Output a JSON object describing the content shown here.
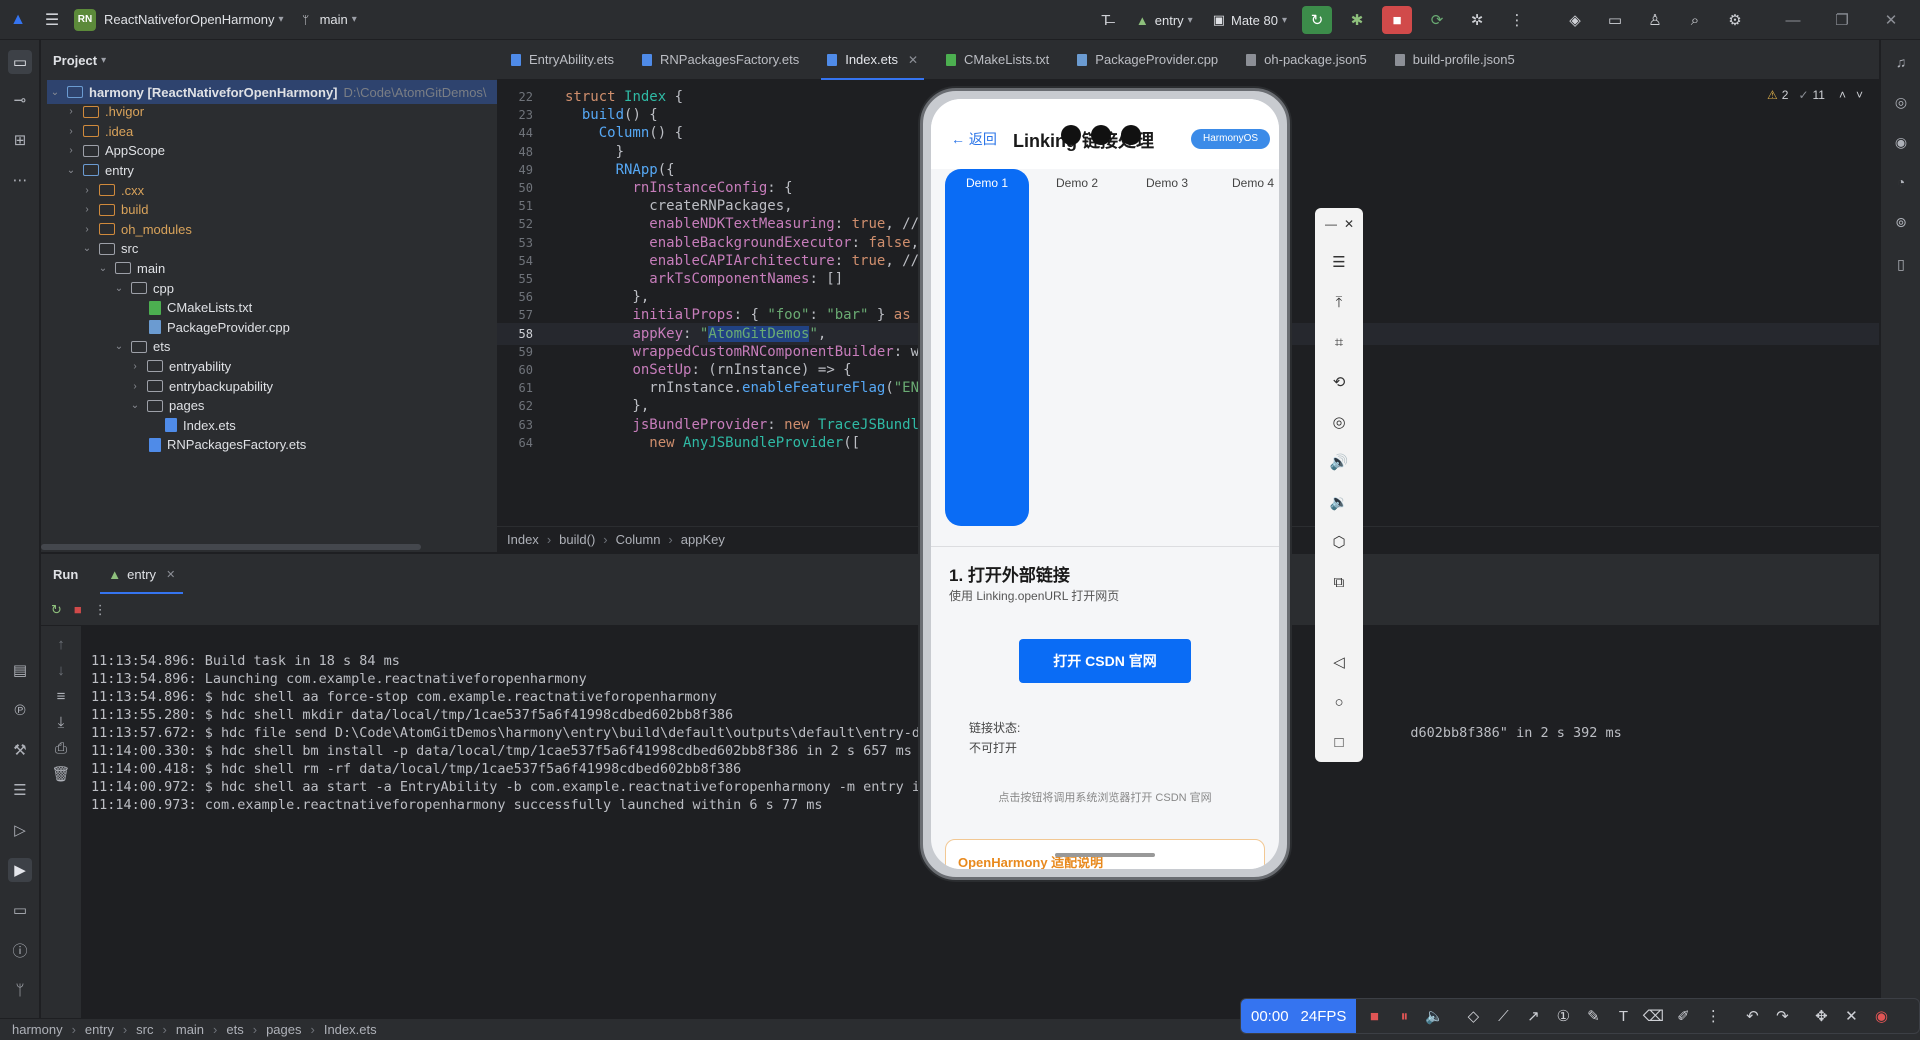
{
  "titlebar": {
    "project_badge": "RN",
    "project_name": "ReactNativeforOpenHarmony",
    "branch": "main",
    "run_config": "entry",
    "device": "Mate 80"
  },
  "project_panel": {
    "title": "Project",
    "tree": [
      {
        "label": "harmony [ReactNativeforOpenHarmony]",
        "extra": "D:\\Code\\AtomGitDemos\\",
        "depth": 0,
        "kind": "module",
        "open": true
      },
      {
        "label": ".hvigor",
        "depth": 1,
        "kind": "orange",
        "open": false
      },
      {
        "label": ".idea",
        "depth": 1,
        "kind": "orange",
        "open": false
      },
      {
        "label": "AppScope",
        "depth": 1,
        "kind": "folder",
        "open": false
      },
      {
        "label": "entry",
        "depth": 1,
        "kind": "module",
        "open": true
      },
      {
        "label": ".cxx",
        "depth": 2,
        "kind": "orange",
        "open": false
      },
      {
        "label": "build",
        "depth": 2,
        "kind": "orange",
        "open": false
      },
      {
        "label": "oh_modules",
        "depth": 2,
        "kind": "orange",
        "open": false
      },
      {
        "label": "src",
        "depth": 2,
        "kind": "folder",
        "open": true
      },
      {
        "label": "main",
        "depth": 3,
        "kind": "folder",
        "open": true
      },
      {
        "label": "cpp",
        "depth": 4,
        "kind": "folder",
        "open": true
      },
      {
        "label": "CMakeLists.txt",
        "depth": 5,
        "kind": "file-cmake"
      },
      {
        "label": "PackageProvider.cpp",
        "depth": 5,
        "kind": "file-cpp"
      },
      {
        "label": "ets",
        "depth": 4,
        "kind": "folder",
        "open": true
      },
      {
        "label": "entryability",
        "depth": 5,
        "kind": "folder",
        "open": false
      },
      {
        "label": "entrybackupability",
        "depth": 5,
        "kind": "folder",
        "open": false
      },
      {
        "label": "pages",
        "depth": 5,
        "kind": "folder",
        "open": true
      },
      {
        "label": "Index.ets",
        "depth": 6,
        "kind": "file-ets"
      },
      {
        "label": "RNPackagesFactory.ets",
        "depth": 5,
        "kind": "file-ets"
      }
    ]
  },
  "editor": {
    "tabs": [
      {
        "label": "EntryAbility.ets",
        "active": false
      },
      {
        "label": "RNPackagesFactory.ets",
        "active": false
      },
      {
        "label": "Index.ets",
        "active": true
      },
      {
        "label": "CMakeLists.txt",
        "active": false
      },
      {
        "label": "PackageProvider.cpp",
        "active": false
      },
      {
        "label": "oh-package.json5",
        "active": false
      },
      {
        "label": "build-profile.json5",
        "active": false
      }
    ],
    "inspections": {
      "warnings": "2",
      "weak": "11"
    },
    "lines": [
      {
        "n": "22",
        "html": "<span class=\"kw\">struct</span> <span class=\"ty\">Index</span> {"
      },
      {
        "n": "23",
        "html": "  <span class=\"fn\">build</span>() {"
      },
      {
        "n": "44",
        "html": "    <span class=\"fn\">Column</span>() {"
      },
      {
        "n": "48",
        "html": "      }"
      },
      {
        "n": "49",
        "html": "      <span class=\"fn\">RNApp</span>({"
      },
      {
        "n": "50",
        "html": "        <span class=\"prop\">rnInstanceConfig</span>: {"
      },
      {
        "n": "51",
        "html": "          createRNPackages,"
      },
      {
        "n": "52",
        "html": "          <span class=\"prop\">enableNDKTextMeasuring</span>: <span class=\"kw\">true</span>, //"
      },
      {
        "n": "53",
        "html": "          <span class=\"prop\">enableBackgroundExecutor</span>: <span class=\"kw\">false</span>,"
      },
      {
        "n": "54",
        "html": "          <span class=\"prop\">enableCAPIArchitecture</span>: <span class=\"kw\">true</span>, //"
      },
      {
        "n": "55",
        "html": "          <span class=\"prop\">arkTsComponentNames</span>: []"
      },
      {
        "n": "56",
        "html": "        },"
      },
      {
        "n": "57",
        "html": "        <span class=\"prop\">initialProps</span>: { <span class=\"str\">\"foo\"</span>: <span class=\"str\">\"bar\"</span> } <span class=\"kw\">as</span>"
      },
      {
        "n": "58",
        "html": "        <span class=\"prop\">appKey</span>: <span class=\"str\">\"<span class=\"sel-word\">AtomGitDemos</span>\"</span>,"
      },
      {
        "n": "59",
        "html": "        <span class=\"prop\">wrappedCustomRNComponentBuilder</span>: wr"
      },
      {
        "n": "60",
        "html": "        <span class=\"prop\">onSetUp</span>: (rnInstance) => {"
      },
      {
        "n": "61",
        "html": "          rnInstance.<span class=\"fn\">enableFeatureFlag</span>(<span class=\"str\">\"EN</span>"
      },
      {
        "n": "62",
        "html": "        },"
      },
      {
        "n": "63",
        "html": "        <span class=\"prop\">jsBundleProvider</span>: <span class=\"kw\">new</span> <span class=\"ty\">TraceJSBundle</span>"
      },
      {
        "n": "64",
        "html": "          <span class=\"kw\">new</span> <span class=\"ty\">AnyJSBundleProvider</span>(["
      }
    ],
    "current_line": "58",
    "breadcrumb": [
      "Index",
      "build()",
      "Column",
      "appKey"
    ]
  },
  "run_panel": {
    "title": "Run",
    "tab": "entry",
    "logs": [
      "11:13:54.896: Build task in 18 s 84 ms",
      "11:13:54.896: Launching com.example.reactnativeforopenharmony",
      "11:13:54.896: $ hdc shell aa force-stop com.example.reactnativeforopenharmony",
      "11:13:55.280: $ hdc shell mkdir data/local/tmp/1cae537f5a6f41998cdbed602bb8f386",
      "11:13:57.672: $ hdc file send D:\\Code\\AtomGitDemos\\harmony\\entry\\build\\default\\outputs\\default\\entry-def",
      "11:14:00.330: $ hdc shell bm install -p data/local/tmp/1cae537f5a6f41998cdbed602bb8f386 in 2 s 657 ms",
      "11:14:00.418: $ hdc shell rm -rf data/local/tmp/1cae537f5a6f41998cdbed602bb8f386",
      "11:14:00.972: $ hdc shell aa start -a EntryAbility -b com.example.reactnativeforopenharmony -m entry in",
      "11:14:00.973: com.example.reactnativeforopenharmony successfully launched within 6 s 77 ms"
    ],
    "log_tail": "419        d602bb8f386\" in 2 s 392 ms"
  },
  "statusbar": {
    "path": [
      "harmony",
      "entry",
      "src",
      "main",
      "ets",
      "pages",
      "Index.ets"
    ]
  },
  "recorder": {
    "time": "00:00",
    "fps": "24FPS"
  },
  "phone": {
    "back_label": "← 返回",
    "title": "Linking 链接处理",
    "pill": "HarmonyOS",
    "demo_tabs": [
      "Demo 1",
      "Demo 2",
      "Demo 3",
      "Demo 4"
    ],
    "section_title": "1. 打开外部链接",
    "section_sub": "使用 Linking.openURL 打开网页",
    "button": "打开 CSDN 官网",
    "status_label": "链接状态:",
    "status_value": "不可打开",
    "hint": "点击按钮将调用系统浏览器打开 CSDN 官网",
    "card_title": "OpenHarmony 适配说明"
  },
  "colors": {
    "accent": "#3574f0",
    "app_primary": "#0a6cf5",
    "run_green": "#3c8c4a",
    "stop_red": "#d14a4a"
  }
}
